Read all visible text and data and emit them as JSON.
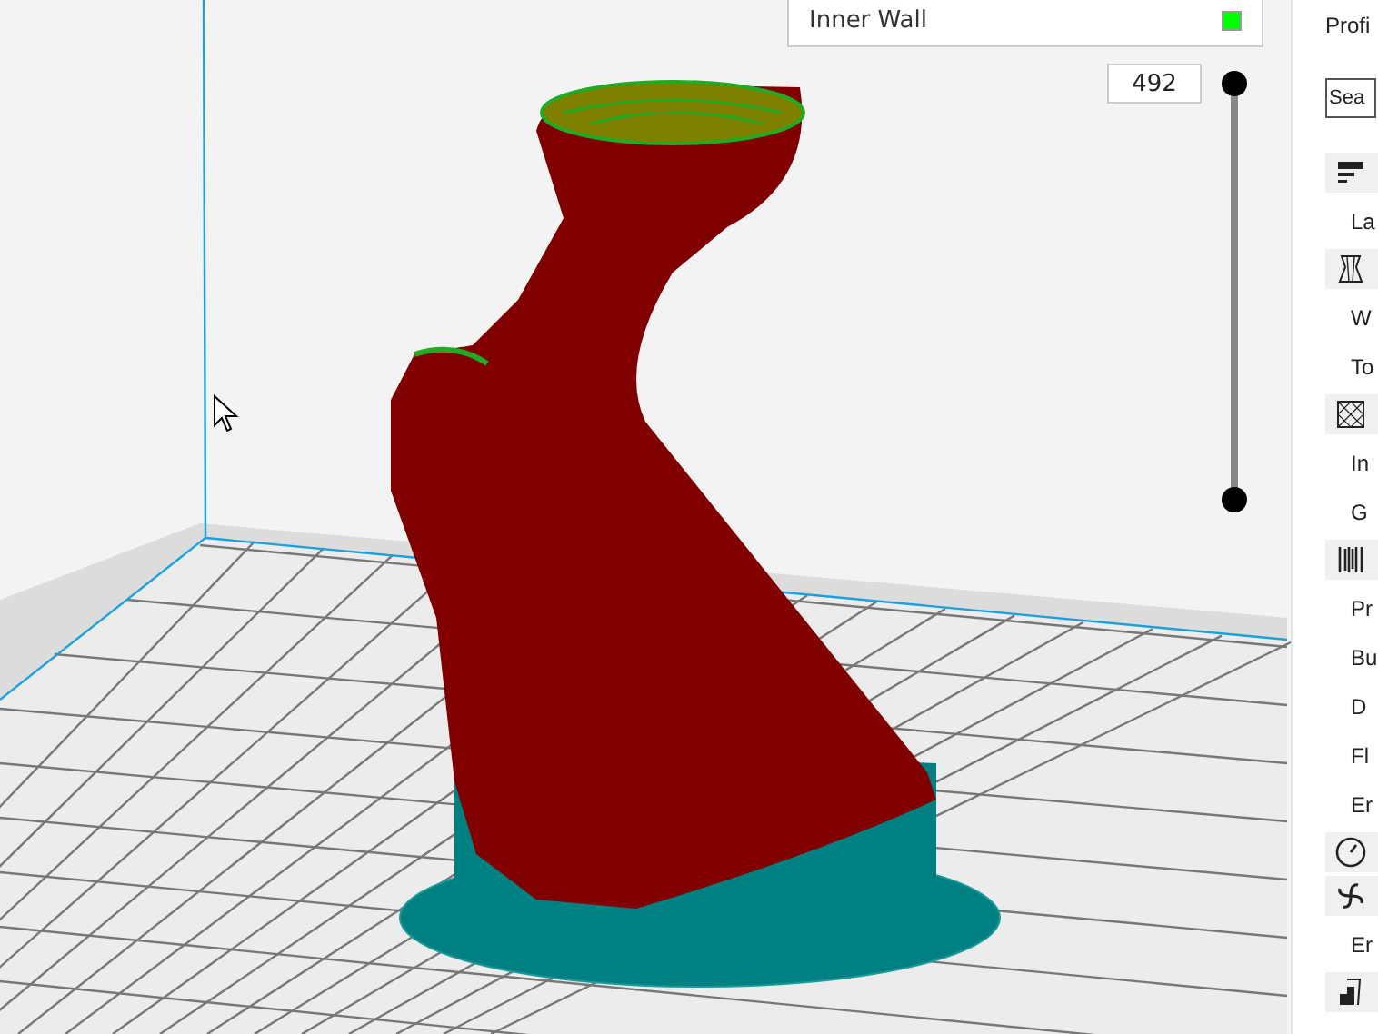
{
  "legend": {
    "items": [
      {
        "label": "Inner Wall",
        "color": "#00ff00"
      }
    ]
  },
  "layer_slider": {
    "value": "492",
    "level": 1
  },
  "sidebar": {
    "title": "Profi",
    "search": {
      "placeholder": "Sea"
    },
    "sections": [
      {
        "kind": "quality",
        "settings": [
          "La"
        ]
      },
      {
        "kind": "shell",
        "settings": [
          "W",
          "To"
        ]
      },
      {
        "kind": "infill",
        "settings": [
          "In",
          "G"
        ]
      },
      {
        "kind": "material",
        "settings": [
          "Pr",
          "Bu",
          "D",
          "Fl",
          "Er"
        ]
      },
      {
        "kind": "speed"
      },
      {
        "kind": "cooling",
        "settings": [
          "Er"
        ]
      },
      {
        "kind": "support"
      }
    ]
  }
}
